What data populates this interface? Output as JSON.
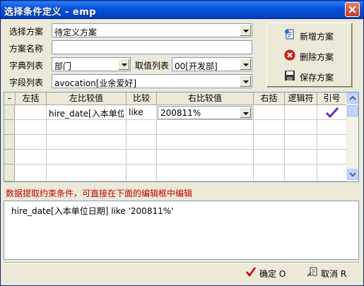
{
  "window": {
    "title": "选择条件定义 - emp"
  },
  "form": {
    "scheme_label": "选择方案",
    "scheme_value": "待定义方案",
    "scheme_name_label": "方案名称",
    "scheme_name_value": "",
    "dict_list_label": "字典列表",
    "dict_list_value": "部门",
    "value_list_label": "取值列表",
    "value_list_value": "00[开发部]",
    "field_list_label": "字段列表",
    "field_list_value": "avocation[业余爱好]"
  },
  "toolbar": {
    "add_label": "新增方案",
    "delete_label": "删除方案",
    "save_label": "保存方案"
  },
  "grid": {
    "gutter_header": "–",
    "columns": [
      "左括",
      "左比较值",
      "比较",
      "右比较值",
      "右括",
      "逻辑符",
      "引号"
    ],
    "rows": [
      {
        "left_paren": "",
        "left_value": "hire_date[入本单位",
        "compare": "like",
        "right_value": "200811%",
        "right_paren": "",
        "logic": "",
        "quote": "✔"
      }
    ]
  },
  "hint": "数据提取约束条件，可直接在下面的编辑框中编辑",
  "editor": {
    "text": "hire_date[入本单位日期]  like '200811%'"
  },
  "footer": {
    "ok_label": "确定 O",
    "cancel_label": "取消 R"
  },
  "colors": {
    "title_bar": "#0854dd",
    "hint_text": "#c00000",
    "check": "#6a2bb8"
  }
}
